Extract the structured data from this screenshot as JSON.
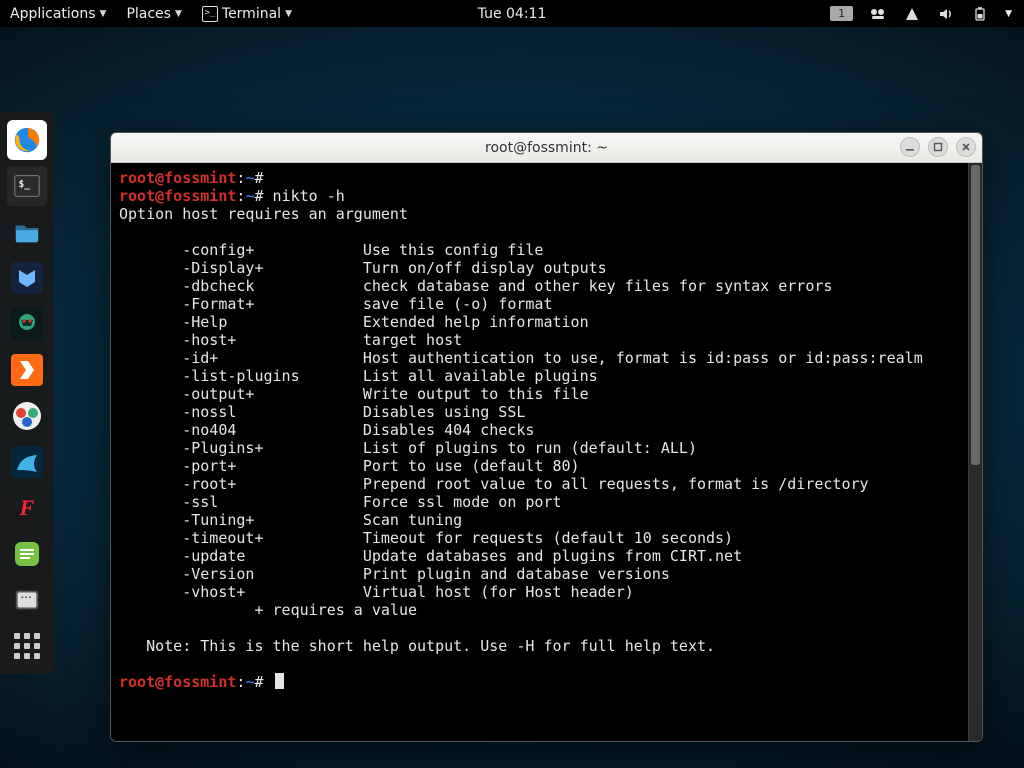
{
  "top": {
    "applications": "Applications",
    "places": "Places",
    "terminal": "Terminal",
    "clock": "Tue 04:11",
    "workspace": "1"
  },
  "window": {
    "title": "root@fossmint: ~"
  },
  "prompt": {
    "user": "root",
    "at": "@",
    "host": "fossmint",
    "colon": ":",
    "path": "~",
    "hash": "#"
  },
  "cmd1": "",
  "cmd2": "nikto -h",
  "err": "Option host requires an argument",
  "options": [
    {
      "flag": "-config+",
      "desc": "Use this config file"
    },
    {
      "flag": "-Display+",
      "desc": "Turn on/off display outputs"
    },
    {
      "flag": "-dbcheck",
      "desc": "check database and other key files for syntax errors"
    },
    {
      "flag": "-Format+",
      "desc": "save file (-o) format"
    },
    {
      "flag": "-Help",
      "desc": "Extended help information"
    },
    {
      "flag": "-host+",
      "desc": "target host"
    },
    {
      "flag": "-id+",
      "desc": "Host authentication to use, format is id:pass or id:pass:realm"
    },
    {
      "flag": "-list-plugins",
      "desc": "List all available plugins"
    },
    {
      "flag": "-output+",
      "desc": "Write output to this file"
    },
    {
      "flag": "-nossl",
      "desc": "Disables using SSL"
    },
    {
      "flag": "-no404",
      "desc": "Disables 404 checks"
    },
    {
      "flag": "-Plugins+",
      "desc": "List of plugins to run (default: ALL)"
    },
    {
      "flag": "-port+",
      "desc": "Port to use (default 80)"
    },
    {
      "flag": "-root+",
      "desc": "Prepend root value to all requests, format is /directory"
    },
    {
      "flag": "-ssl",
      "desc": "Force ssl mode on port"
    },
    {
      "flag": "-Tuning+",
      "desc": "Scan tuning"
    },
    {
      "flag": "-timeout+",
      "desc": "Timeout for requests (default 10 seconds)"
    },
    {
      "flag": "-update",
      "desc": "Update databases and plugins from CIRT.net"
    },
    {
      "flag": "-Version",
      "desc": "Print plugin and database versions"
    },
    {
      "flag": "-vhost+",
      "desc": "Virtual host (for Host header)"
    }
  ],
  "footer1": "               + requires a value",
  "footer2": "   Note: This is the short help output. Use -H for full help text."
}
